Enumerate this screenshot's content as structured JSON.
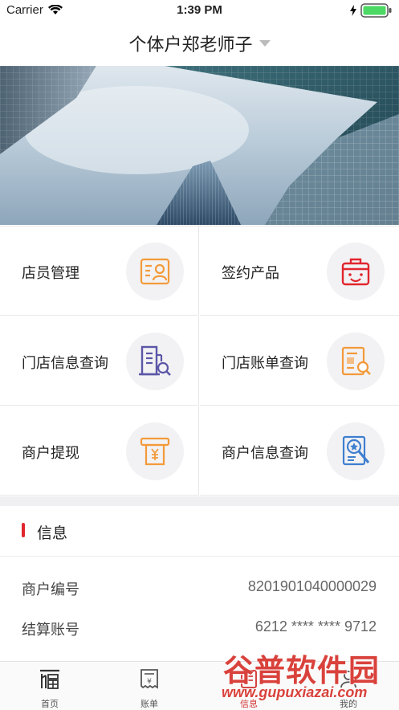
{
  "status_bar": {
    "carrier": "Carrier",
    "time": "1:39 PM"
  },
  "nav": {
    "title": "个体户郑老师子"
  },
  "grid": [
    {
      "label": "店员管理",
      "icon": "clerk-card-icon"
    },
    {
      "label": "签约产品",
      "icon": "product-bag-icon"
    },
    {
      "label": "门店信息查询",
      "icon": "store-info-icon"
    },
    {
      "label": "门店账单查询",
      "icon": "store-bill-icon"
    },
    {
      "label": "商户提现",
      "icon": "withdraw-icon"
    },
    {
      "label": "商户信息查询",
      "icon": "merchant-info-icon"
    }
  ],
  "info": {
    "title": "信息",
    "rows": [
      {
        "key": "商户编号",
        "value": "8201901040000029"
      },
      {
        "key": "结算账号",
        "value": "6212 **** **** 9712"
      }
    ]
  },
  "tabs": [
    {
      "label": "首页",
      "icon": "home-icon"
    },
    {
      "label": "账单",
      "icon": "bill-icon"
    },
    {
      "label": "信息",
      "icon": "info-icon"
    },
    {
      "label": "我的",
      "icon": "profile-icon"
    }
  ],
  "watermark": {
    "cn": "谷普软件园",
    "en": "www.gupuxiazai.com"
  },
  "colors": {
    "accent": "#e1262e",
    "orange": "#f39a3a",
    "purple": "#5b56a8",
    "blue": "#3f7fd0"
  }
}
